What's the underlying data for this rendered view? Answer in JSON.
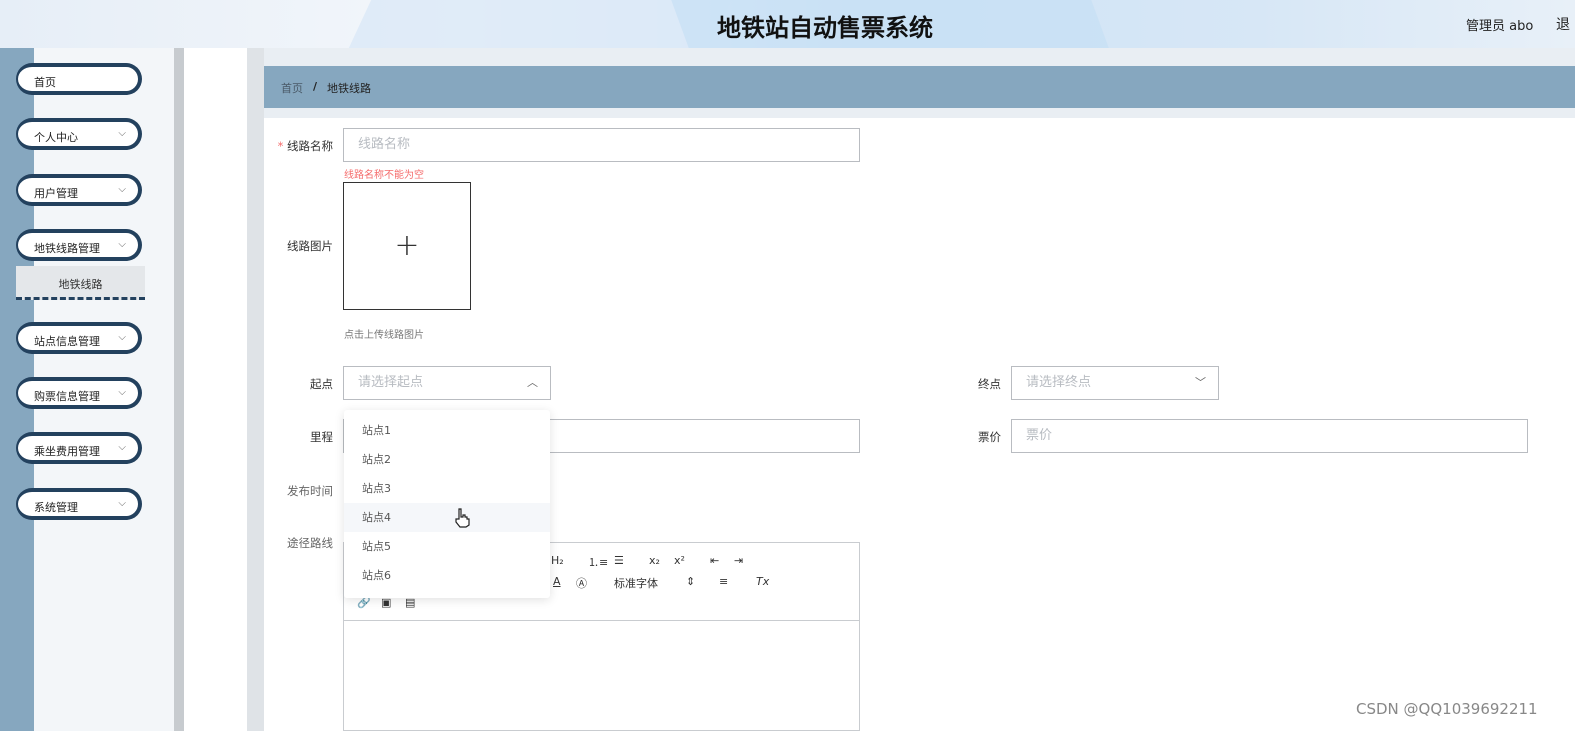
{
  "header": {
    "title": "地铁站自动售票系统",
    "user": "管理员 abo",
    "logout": "退"
  },
  "sidebar": {
    "items": [
      {
        "label": "首页",
        "chevron": ""
      },
      {
        "label": "个人中心",
        "chevron": "⌵"
      },
      {
        "label": "用户管理",
        "chevron": "⌵"
      },
      {
        "label": "地铁线路管理",
        "chevron": "⌵"
      },
      {
        "label": "站点信息管理",
        "chevron": "⌵"
      },
      {
        "label": "购票信息管理",
        "chevron": "⌵"
      },
      {
        "label": "乘坐费用管理",
        "chevron": "⌵"
      },
      {
        "label": "系统管理",
        "chevron": "⌵"
      }
    ],
    "sub_item": "地铁线路"
  },
  "breadcrumb": {
    "home": "首页",
    "sep": "/",
    "current": "地铁线路"
  },
  "form": {
    "route_name": {
      "label": "线路名称",
      "required": "*",
      "placeholder": "线路名称",
      "error": "线路名称不能为空"
    },
    "route_image": {
      "label": "线路图片",
      "plus": "+",
      "hint": "点击上传线路图片"
    },
    "start": {
      "label": "起点",
      "placeholder": "请选择起点",
      "arrow": "︿"
    },
    "end": {
      "label": "终点",
      "placeholder": "请选择终点",
      "arrow": "﹀"
    },
    "mileage": {
      "label": "里程",
      "placeholder": ""
    },
    "price": {
      "label": "票价",
      "placeholder": "票价"
    },
    "publish_time": {
      "label": "发布时间"
    },
    "route_path": {
      "label": "途径路线"
    }
  },
  "dropdown": {
    "options": [
      "站点1",
      "站点2",
      "站点3",
      "站点4",
      "站点5",
      "站点6"
    ],
    "hovered_index": 3
  },
  "editor": {
    "toolbar_row1": [
      "H₂",
      "⒈≡",
      "☰",
      "x₂",
      "x²",
      "⇤",
      "⇥"
    ],
    "toolbar_row2": [
      "A",
      "Ⓐ",
      "标准字体",
      "⇕",
      "≡",
      "Tx"
    ],
    "toolbar_row3": [
      "🔗",
      "▣",
      "▤"
    ]
  },
  "watermark": "CSDN @QQ1039692211",
  "icons": {
    "cursor": "hand-pointer-icon"
  }
}
